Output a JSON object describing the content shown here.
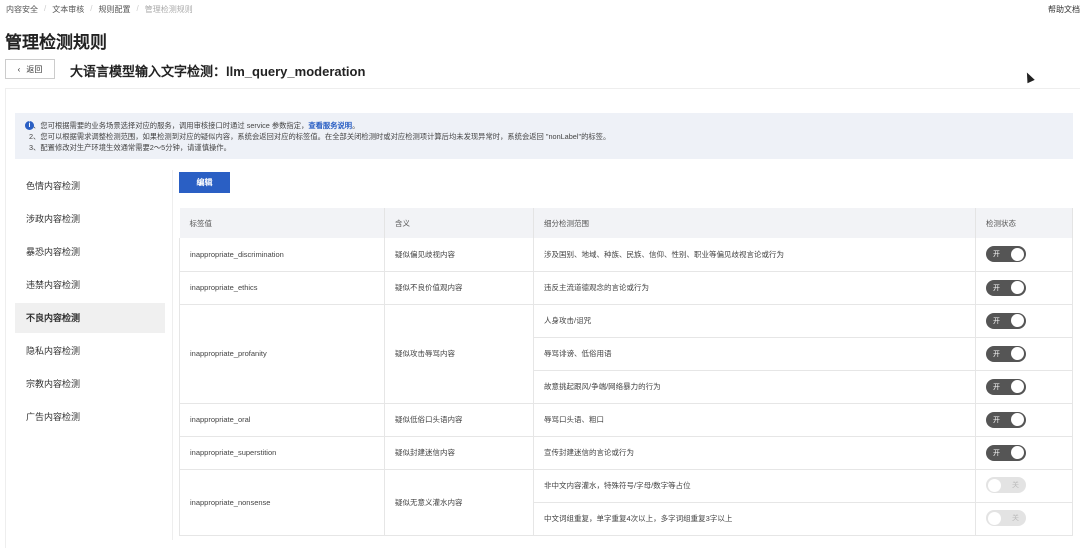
{
  "breadcrumb": [
    "内容安全",
    "文本审核",
    "规则配置",
    "管理检测规则"
  ],
  "help_link": "帮助文档",
  "page_title": "管理检测规则",
  "back_label": "返回",
  "subtitle": "大语言模型输入文字检测：llm_query_moderation",
  "notice": {
    "line1": "1、您可根据需要的业务场景选择对应的服务，调用审核接口时通过 service 参数指定，",
    "line1_link": "查看服务说明",
    "line1_end": "。",
    "line2": "2、您可以根据需求调整检测范围，如果检测到对应的疑似内容，系统会返回对应的标签值。在全部关闭检测时或对应检测项计算后均未发现异常时，系统会返回 \"nonLabel\"的标签。",
    "line3": "3、配置修改对生产环境生效通常需要2～5分钟，请谨慎操作。"
  },
  "sidebar": [
    "色情内容检测",
    "涉政内容检测",
    "暴恐内容检测",
    "违禁内容检测",
    "不良内容检测",
    "隐私内容检测",
    "宗教内容检测",
    "广告内容检测"
  ],
  "active_sidebar": "不良内容检测",
  "edit_label": "编辑",
  "table": {
    "headers": [
      "标签值",
      "含义",
      "细分检测范围",
      "检测状态"
    ],
    "groups": [
      {
        "label": "inappropriate_discrimination",
        "meaning": "疑似偏见歧视内容",
        "items": [
          {
            "scope": "涉及国别、地域、种族、民族、信仰、性别、职业等偏见歧视言论或行为",
            "state": "开",
            "on": true
          }
        ]
      },
      {
        "label": "inappropriate_ethics",
        "meaning": "疑似不良价值观内容",
        "items": [
          {
            "scope": "违反主流道德观念的言论或行为",
            "state": "开",
            "on": true
          }
        ]
      },
      {
        "label": "inappropriate_profanity",
        "meaning": "疑似攻击辱骂内容",
        "items": [
          {
            "scope": "人身攻击/诅咒",
            "state": "开",
            "on": true
          },
          {
            "scope": "辱骂诽谤、低俗用语",
            "state": "开",
            "on": true
          },
          {
            "scope": "故意挑起跟风/争端/网络暴力的行为",
            "state": "开",
            "on": true
          }
        ]
      },
      {
        "label": "inappropriate_oral",
        "meaning": "疑似低俗口头语内容",
        "items": [
          {
            "scope": "辱骂口头语、粗口",
            "state": "开",
            "on": true
          }
        ]
      },
      {
        "label": "inappropriate_superstition",
        "meaning": "疑似封建迷信内容",
        "items": [
          {
            "scope": "宣传封建迷信的言论或行为",
            "state": "开",
            "on": true
          }
        ]
      },
      {
        "label": "inappropriate_nonsense",
        "meaning": "疑似无意义灌水内容",
        "items": [
          {
            "scope": "非中文内容灌水，特殊符号/字母/数字等占位",
            "state": "关",
            "on": false
          },
          {
            "scope": "中文词组重复，单字重复4次以上，多字词组重复3字以上",
            "state": "关",
            "on": false
          }
        ]
      }
    ]
  }
}
